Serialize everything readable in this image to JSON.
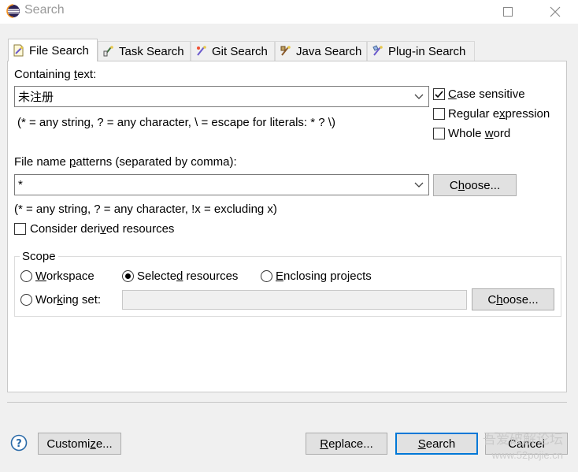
{
  "window": {
    "title": "Search"
  },
  "tabs": [
    {
      "label": "File Search",
      "icon": "file-search-icon",
      "active": true
    },
    {
      "label": "Task Search",
      "icon": "task-search-icon"
    },
    {
      "label": "Git Search",
      "icon": "git-search-icon"
    },
    {
      "label": "Java Search",
      "icon": "java-search-icon"
    },
    {
      "label": "Plug-in Search",
      "icon": "plugin-search-icon"
    }
  ],
  "containing": {
    "label_pre": "Containing ",
    "label_u": "t",
    "label_post": "ext:",
    "value": "未注册",
    "hint": "(* = any string, ? = any character, \\ = escape for literals: * ? \\)"
  },
  "options": {
    "case_sensitive": {
      "u": "C",
      "rest": "ase sensitive",
      "checked": true
    },
    "regex": {
      "pre": "Regular e",
      "u": "x",
      "post": "pression",
      "checked": false
    },
    "whole_word": {
      "pre": "Whole ",
      "u": "w",
      "post": "ord",
      "checked": false
    }
  },
  "patterns": {
    "label_pre": "File name ",
    "label_u": "p",
    "label_post": "atterns (separated by comma):",
    "value": "*",
    "choose_pre": "C",
    "choose_u": "h",
    "choose_post": "oose...",
    "hint": "(* = any string, ? = any character, !x = excluding x)"
  },
  "derived": {
    "pre": "Consider deri",
    "u": "v",
    "post": "ed resources",
    "checked": false
  },
  "scope": {
    "label": "Scope",
    "workspace": {
      "u": "W",
      "rest": "orkspace",
      "selected": false
    },
    "selected_resources": {
      "pre": "Selecte",
      "u": "d",
      "post": " resources",
      "selected": true
    },
    "enclosing": {
      "pre": "",
      "u": "E",
      "post": "nclosing projects",
      "selected": false
    },
    "working_set": {
      "pre": "Wor",
      "u": "k",
      "post": "ing set:",
      "selected": false,
      "value": ""
    },
    "choose_pre": "C",
    "choose_u": "h",
    "choose_post": "oose..."
  },
  "footer": {
    "customize_pre": "Customi",
    "customize_u": "z",
    "customize_post": "e...",
    "replace_u": "R",
    "replace_post": "eplace...",
    "search_u": "S",
    "search_post": "earch",
    "cancel": "Cancel"
  },
  "watermark": {
    "line1": "吾爱破解论坛",
    "line2": "www.52pojie.cn"
  },
  "colors": {
    "accent": "#0078d7",
    "panel_border": "#c8c8c8"
  }
}
